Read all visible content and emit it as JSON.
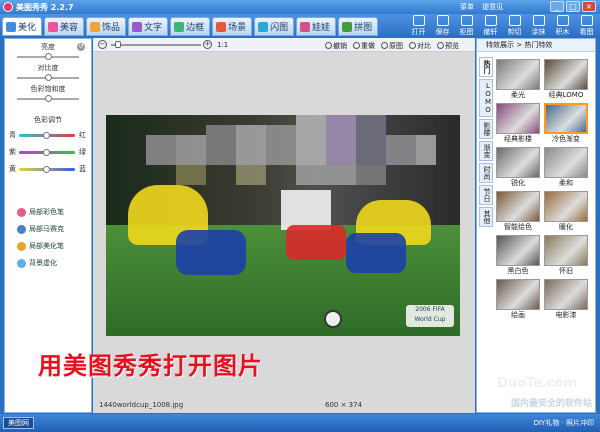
{
  "app": {
    "title": "美图秀秀 2.2.7"
  },
  "top_links": [
    "菜单",
    "提意见"
  ],
  "window_buttons": [
    "_",
    "□",
    "×"
  ],
  "tabs": [
    {
      "label": "美化",
      "color": "#3e8fe0"
    },
    {
      "label": "美容",
      "color": "#e8559a"
    },
    {
      "label": "饰品",
      "color": "#f2a23a"
    },
    {
      "label": "文字",
      "color": "#9b59d0"
    },
    {
      "label": "边框",
      "color": "#3bb57a"
    },
    {
      "label": "场景",
      "color": "#e45a3a"
    },
    {
      "label": "闪图",
      "color": "#2aa8d8"
    },
    {
      "label": "娃娃",
      "color": "#d84f8a"
    },
    {
      "label": "拼图",
      "color": "#3f9f3f"
    }
  ],
  "toolbar": [
    "打开",
    "保存",
    "拒图",
    "撤轩",
    "剪切",
    "涂抹",
    "积木",
    "看图"
  ],
  "left_panel": {
    "brightness": "亮度",
    "contrast": "对比度",
    "saturation": "色彩饱和度",
    "color_adjust": "色彩调节",
    "pairs": [
      {
        "left": "青",
        "right": "红"
      },
      {
        "left": "紫",
        "right": "绿"
      },
      {
        "left": "黄",
        "right": "蓝"
      }
    ],
    "brushes": [
      {
        "label": "局部彩色笔",
        "color": "#e85b8a"
      },
      {
        "label": "局部马赛克",
        "color": "#4a7fd0"
      },
      {
        "label": "局部美化笔",
        "color": "#f0a028"
      },
      {
        "label": "背景虚化",
        "color": "#5bb0e8"
      }
    ]
  },
  "canvas": {
    "ratio": "1:1",
    "actions": [
      "撤销",
      "重做",
      "原图",
      "对比",
      "预览"
    ],
    "file_name": "1440worldcup_1008.jpg",
    "dimensions": "600 × 374",
    "caption": "用美图秀秀打开图片"
  },
  "right_panel": {
    "header": "特效展示 > 热门特效",
    "vtabs": [
      "热门",
      "LOMO",
      "影楼",
      "渐变",
      "时尚",
      "节日",
      "其他"
    ],
    "thumbs": [
      {
        "label": "柔光",
        "tone": "#7a7a7a"
      },
      {
        "label": "经典LOMO",
        "tone": "#5a4a3a"
      },
      {
        "label": "经典影楼",
        "tone": "#8a4a7a"
      },
      {
        "label": "冷色渐变",
        "tone": "#4a6a8a"
      },
      {
        "label": "锐化",
        "tone": "#6a6a6a"
      },
      {
        "label": "柔和",
        "tone": "#8a8a8a"
      },
      {
        "label": "智能绘色",
        "tone": "#7a5a3a"
      },
      {
        "label": "暖化",
        "tone": "#9a6a3a"
      },
      {
        "label": "黑白色",
        "tone": "#555555"
      },
      {
        "label": "怀旧",
        "tone": "#8a7a5a"
      },
      {
        "label": "绘画",
        "tone": "#6a5a4a"
      },
      {
        "label": "电影漆",
        "tone": "#7a6a5a"
      }
    ]
  },
  "bottom": {
    "chip": "美图网",
    "right": "DIY礼物 · 照片冲印",
    "watermark": "DuoTe.com",
    "site_tag": "国内最安全的软件站"
  }
}
